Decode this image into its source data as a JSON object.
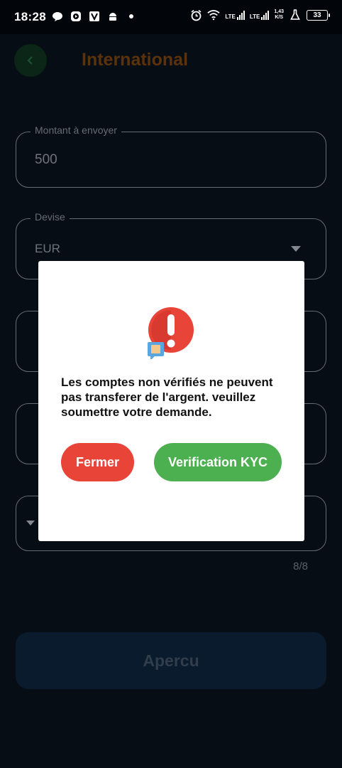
{
  "status_bar": {
    "time": "18:28",
    "left_icons": [
      "chat-bubble-icon",
      "play-icon",
      "v-app-icon",
      "android-icon",
      "dot-icon"
    ],
    "net_label_1": "LTE",
    "net_label_2": "LTE",
    "speed_top": "1,43",
    "speed_bottom": "K/S",
    "battery": "33"
  },
  "header": {
    "title": "International",
    "back_icon": "chevron-left-icon"
  },
  "form": {
    "amount": {
      "label": "Montant à envoyer",
      "value": "500"
    },
    "currency": {
      "label": "Devise",
      "value": "EUR"
    },
    "counter": "8/8",
    "preview_label": "Apercu"
  },
  "dialog": {
    "icon": "alert-exclamation-icon",
    "message": "Les comptes non vérifiés ne peuvent pas transferer de l'argent. veuillez soumettre votre demande.",
    "close_label": "Fermer",
    "kyc_label": "Verification KYC"
  },
  "colors": {
    "background": "#0b1420",
    "title": "#8a4d12",
    "close_button": "#e84438",
    "kyc_button": "#4caf50",
    "preview_button": "#0f2a45"
  }
}
